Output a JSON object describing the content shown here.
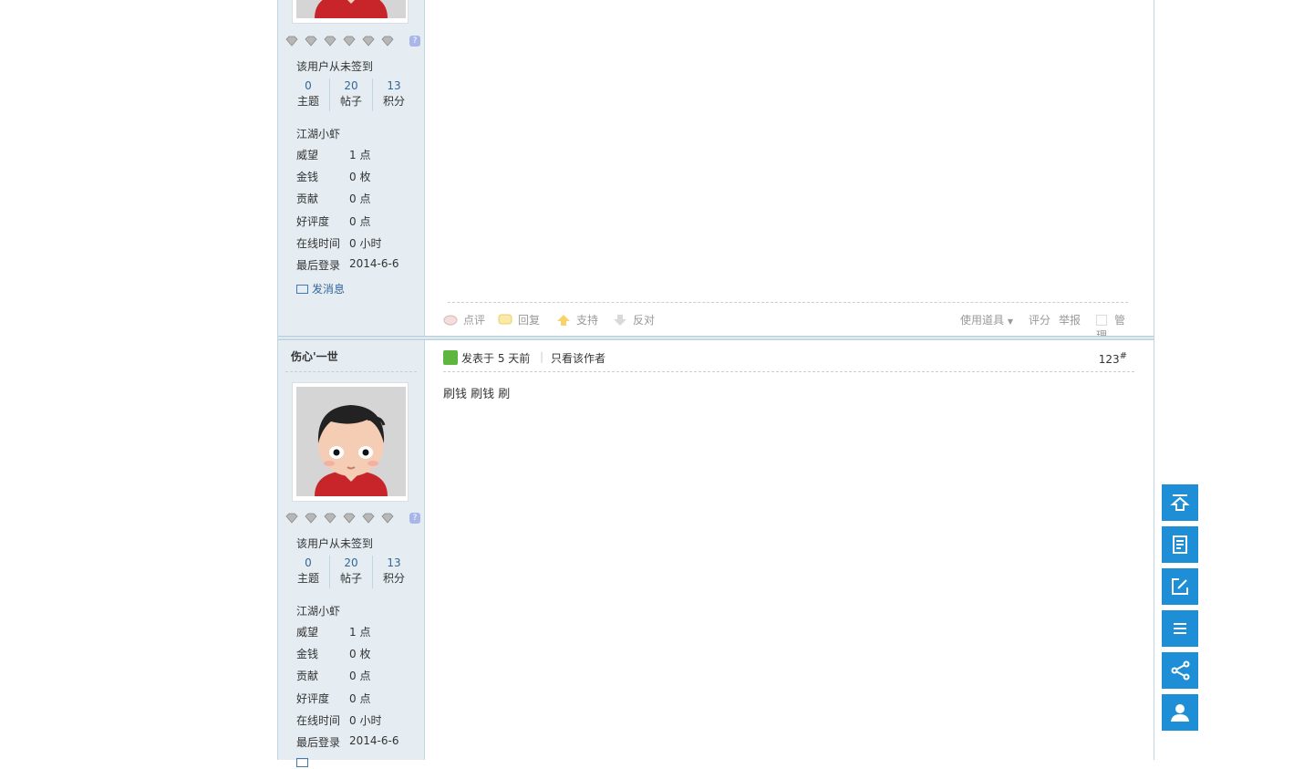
{
  "posts": [
    {
      "unsigned_text": "该用户从未签到",
      "stats": [
        {
          "num": "0",
          "label": "主题"
        },
        {
          "num": "20",
          "label": "帖子"
        },
        {
          "num": "13",
          "label": "积分"
        }
      ],
      "rank": "江湖小虾",
      "fields": [
        {
          "k": "威望",
          "v": "1 点"
        },
        {
          "k": "金钱",
          "v": "0 枚"
        },
        {
          "k": "贡献",
          "v": "0 点"
        },
        {
          "k": "好评度",
          "v": "0 点"
        },
        {
          "k": "在线时间",
          "v": "0 小时"
        },
        {
          "k": "最后登录",
          "v": "2014-6-6"
        }
      ],
      "send_message": "发消息",
      "actions": {
        "comment": "点评",
        "reply": "回复",
        "support": "支持",
        "oppose": "反对",
        "use_tool": "使用道具",
        "rate": "评分",
        "report": "举报",
        "manage": "管理"
      }
    },
    {
      "username": "伤心'一世",
      "unsigned_text": "该用户从未签到",
      "stats": [
        {
          "num": "0",
          "label": "主题"
        },
        {
          "num": "20",
          "label": "帖子"
        },
        {
          "num": "13",
          "label": "积分"
        }
      ],
      "rank": "江湖小虾",
      "fields": [
        {
          "k": "威望",
          "v": "1 点"
        },
        {
          "k": "金钱",
          "v": "0 枚"
        },
        {
          "k": "贡献",
          "v": "0 点"
        },
        {
          "k": "好评度",
          "v": "0 点"
        },
        {
          "k": "在线时间",
          "v": "0 小时"
        },
        {
          "k": "最后登录",
          "v": "2014-6-6"
        }
      ],
      "posted": "发表于 5 天前",
      "separator": "|",
      "only_author": "只看该作者",
      "floor_num": "123",
      "floor_mark": "#",
      "body": "刷钱 刷钱 刷"
    }
  ],
  "avatar_help": "?",
  "float_tools": [
    "back-to-top-icon",
    "quick-reply-icon",
    "new-post-icon",
    "forum-list-icon",
    "share-icon",
    "user-icon"
  ],
  "colors": {
    "accent": "#1e8fd6",
    "sidebar": "#e5edf2",
    "border": "#c2d5e3",
    "link": "#336699"
  }
}
